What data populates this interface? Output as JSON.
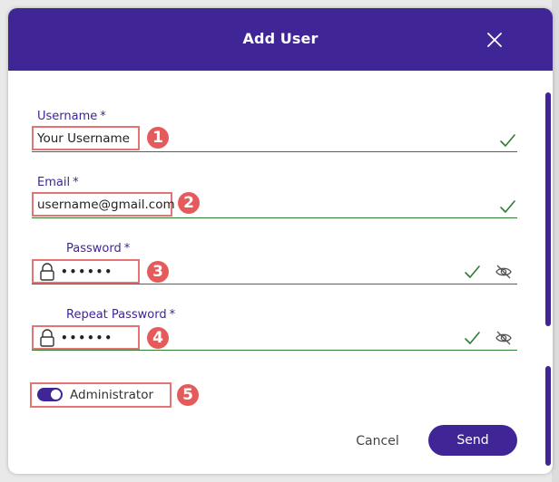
{
  "dialog": {
    "title": "Add User"
  },
  "form": {
    "username": {
      "label": "Username",
      "required_mark": "*",
      "value": "Your Username",
      "badge": "1"
    },
    "email": {
      "label": "Email",
      "required_mark": "*",
      "value": "username@gmail.com",
      "badge": "2"
    },
    "password": {
      "label": "Password",
      "required_mark": "*",
      "value": "••••••",
      "badge": "3"
    },
    "repeat_password": {
      "label": "Repeat Password",
      "required_mark": "*",
      "value": "••••••",
      "badge": "4"
    },
    "administrator": {
      "label": "Administrator",
      "checked": true,
      "badge": "5"
    }
  },
  "actions": {
    "cancel_label": "Cancel",
    "send_label": "Send"
  },
  "colors": {
    "primary": "#3f2596",
    "valid": "#2e7d32",
    "annotation": "#e55b5b"
  },
  "icons": [
    "close-icon",
    "checkmark-icon",
    "lock-icon",
    "eye-off-icon",
    "toggle-switch"
  ]
}
